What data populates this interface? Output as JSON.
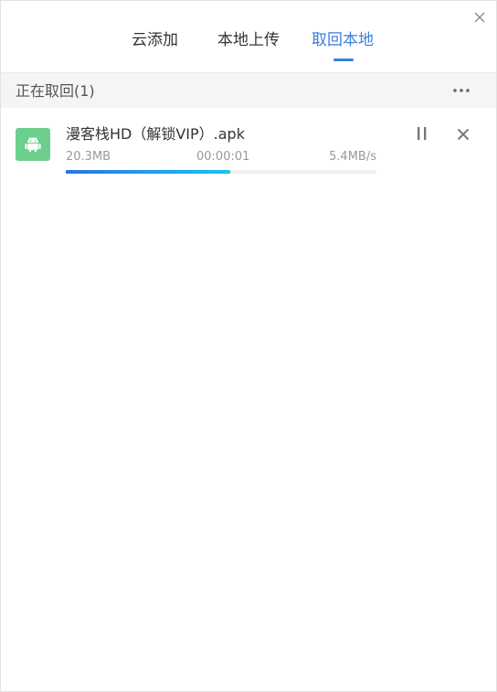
{
  "tabs": [
    {
      "label": "云添加"
    },
    {
      "label": "本地上传"
    },
    {
      "label": "取回本地",
      "active": true
    }
  ],
  "section": {
    "title": "正在取回(1)"
  },
  "downloads": [
    {
      "file_name": "漫客栈HD（解锁VIP）.apk",
      "size": "20.3MB",
      "elapsed": "00:00:01",
      "speed": "5.4MB/s",
      "progress_percent": 53,
      "icon": "android-icon"
    }
  ],
  "colors": {
    "accent": "#3b7ddd",
    "icon_bg": "#6ccf8d",
    "progress_start": "#2b74e8",
    "progress_end": "#18c3f0"
  }
}
